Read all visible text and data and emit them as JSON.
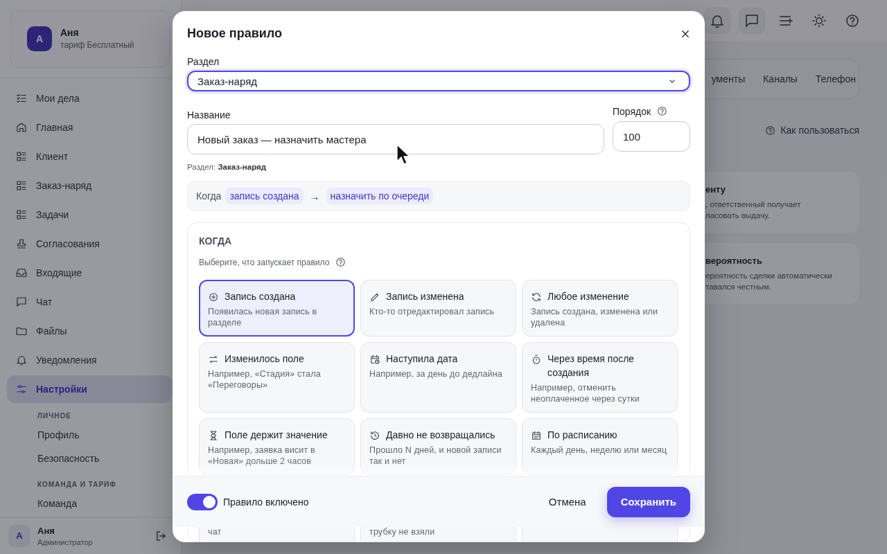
{
  "sidebar": {
    "profile": {
      "avatar": "А",
      "name": "Аня",
      "plan": "тариф Бесплатный"
    },
    "items": [
      {
        "label": "Мои дела",
        "selected": false
      },
      {
        "label": "Главная",
        "selected": false
      },
      {
        "label": "Клиент",
        "selected": false
      },
      {
        "label": "Заказ-наряд",
        "selected": false
      },
      {
        "label": "Задачи",
        "selected": false
      },
      {
        "label": "Согласования",
        "selected": false
      },
      {
        "label": "Входящие",
        "selected": false
      },
      {
        "label": "Чат",
        "selected": false
      },
      {
        "label": "Файлы",
        "selected": false
      },
      {
        "label": "Уведомления",
        "selected": false
      },
      {
        "label": "Настройки",
        "selected": true
      }
    ],
    "sections": [
      {
        "title": "ЛИЧНОЕ",
        "items": [
          {
            "label": "Профиль",
            "selected": false
          },
          {
            "label": "Безопасность",
            "selected": false
          }
        ]
      },
      {
        "title": "КОМАНДА И ТАРИФ",
        "items": [
          {
            "label": "Команда",
            "selected": false
          }
        ]
      }
    ],
    "user": {
      "avatar": "А",
      "name": "Аня",
      "role": "Администратор"
    }
  },
  "background": {
    "tabs": [
      {
        "label": "ументы"
      },
      {
        "label": "Каналы"
      },
      {
        "label": "Телефон"
      }
    ],
    "help_link": "Как пользоваться",
    "cards": [
      {
        "title": "енту",
        "lines": [
          ", ответственный получает",
          "ласовать выдачу."
        ]
      },
      {
        "title": "вероятность",
        "lines": [
          "ероятность сделки автоматически",
          "тавался честным."
        ]
      }
    ]
  },
  "modal": {
    "title": "Новое правило",
    "section_field": {
      "label": "Раздел",
      "value": "Заказ-наряд"
    },
    "name_field": {
      "label": "Название",
      "value": "Новый заказ — назначить мастера"
    },
    "order_field": {
      "label": "Порядок",
      "value": "100"
    },
    "hint": "Раздел: **Заказ-наряд**",
    "summary": {
      "prefix": "Когда",
      "trigger": "запись создана",
      "arrow": "→",
      "action": "назначить по очереди"
    },
    "when": {
      "title": "КОГДА",
      "subtitle": "Выберите, что запускает правило",
      "options": [
        {
          "kind": "option",
          "title": "Запись создана",
          "description": "Появилась новая запись в разделе",
          "selected": true
        },
        {
          "kind": "option",
          "title": "Запись изменена",
          "description": "Кто-то отредактировал запись",
          "selected": false
        },
        {
          "kind": "option",
          "title": "Любое изменение",
          "description": "Запись создана, изменена или удалена",
          "selected": false
        },
        {
          "kind": "option",
          "title": "Изменилось поле",
          "description": "Например, «Стадия» стала «Переговоры»",
          "selected": false
        },
        {
          "kind": "option",
          "title": "Наступила дата",
          "description": "Например, за день до дедлайна",
          "selected": false
        },
        {
          "kind": "option",
          "title": "Через время после создания",
          "description": "Например, отменить неоплаченное через сутки",
          "selected": false
        },
        {
          "kind": "option",
          "title": "Поле держит значение",
          "description": "Например, заявка висит в «Новая» дольше 2 часов",
          "selected": false
        },
        {
          "kind": "option",
          "title": "Давно не возвращались",
          "description": "Прошло N дней, и новой записи так и нет",
          "selected": false
        },
        {
          "kind": "option",
          "title": "По расписанию",
          "description": "Каждый день, неделю или месяц",
          "selected": false
        },
        {
          "kind": "cut",
          "description": "чат",
          "selected": false
        },
        {
          "kind": "cut",
          "description": "трубку не взяли",
          "selected": false
        },
        {
          "kind": "cut",
          "selected": false
        }
      ]
    },
    "footer": {
      "toggle": {
        "label": "Правило включено",
        "on": true
      },
      "cancel": "Отмена",
      "save": "Сохранить"
    }
  }
}
